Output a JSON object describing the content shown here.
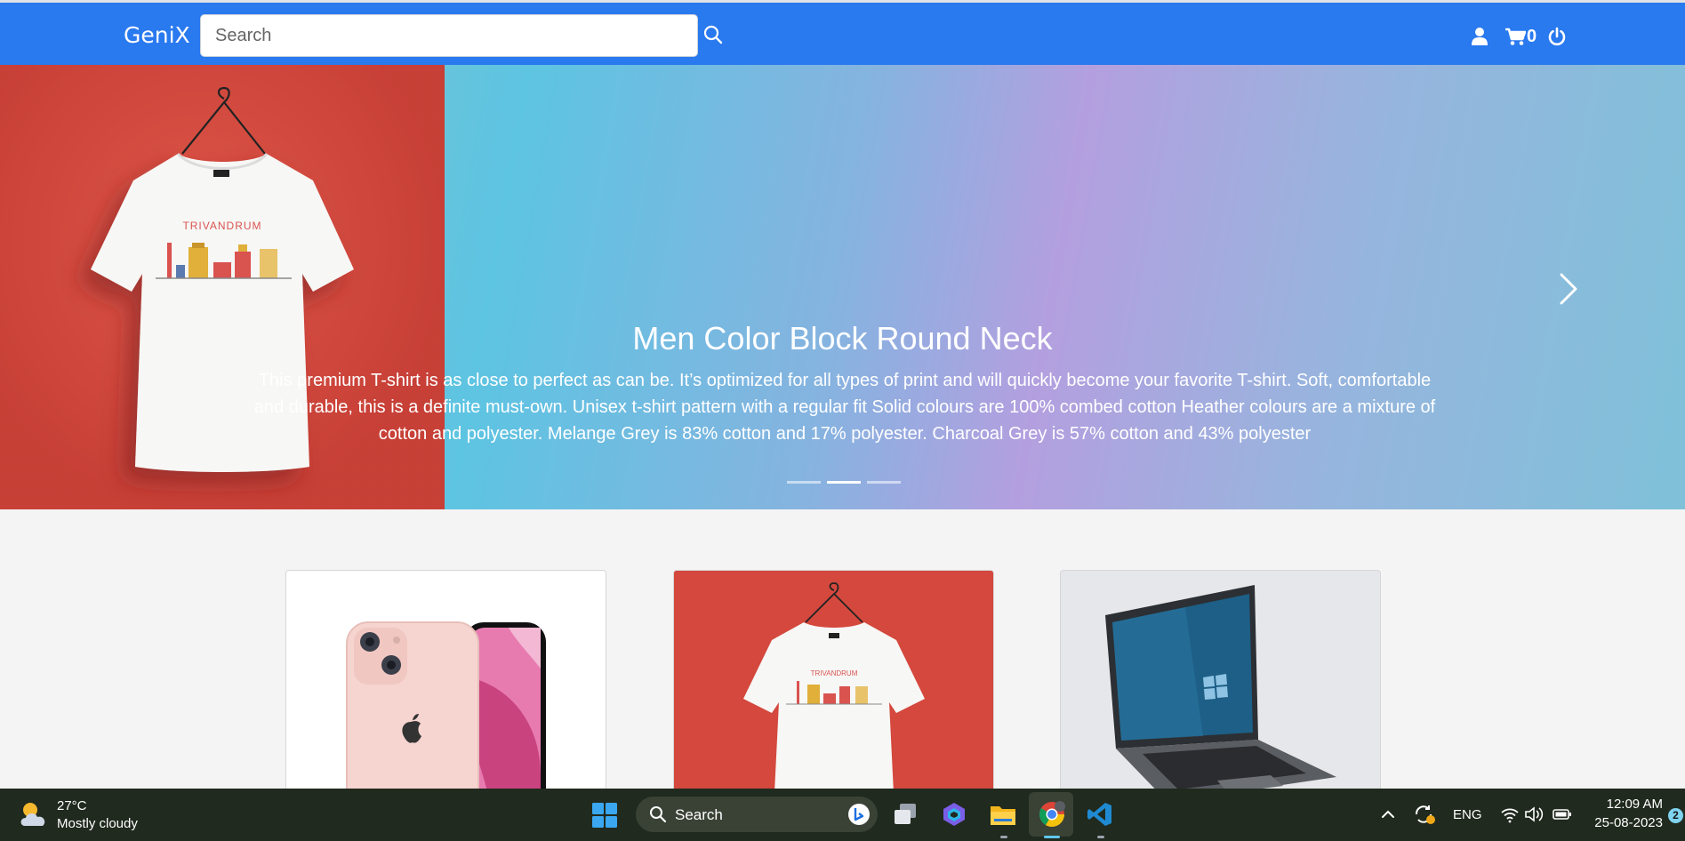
{
  "navbar": {
    "brand": "GeniX",
    "search_placeholder": "Search",
    "cart_count": "0",
    "color": "#2979ef"
  },
  "carousel": {
    "title": "Men Color Block Round Neck",
    "description": "This premium T-shirt is as close to perfect as can be. It’s optimized for all types of print and will quickly become your favorite T-shirt. Soft, comfortable and durable, this is a definite must-own. Unisex t-shirt pattern with a regular fit Solid colours are 100% combed cotton Heather colours are a mixture of cotton and polyester. Melange Grey is 83% cotton and 17% polyester. Charcoal Grey is 57% cotton and 43% polyester",
    "tshirt_print": "TRIVANDRUM",
    "slide_count": 3,
    "active_slide": 2
  },
  "products": [
    {
      "image": "iphone-pink"
    },
    {
      "image": "tshirt-trivandrum"
    },
    {
      "image": "laptop"
    }
  ],
  "taskbar": {
    "weather_temp": "27°C",
    "weather_desc": "Mostly cloudy",
    "search_label": "Search",
    "language": "ENG",
    "time": "12:09 AM",
    "date": "25-08-2023",
    "notifications": "2"
  }
}
